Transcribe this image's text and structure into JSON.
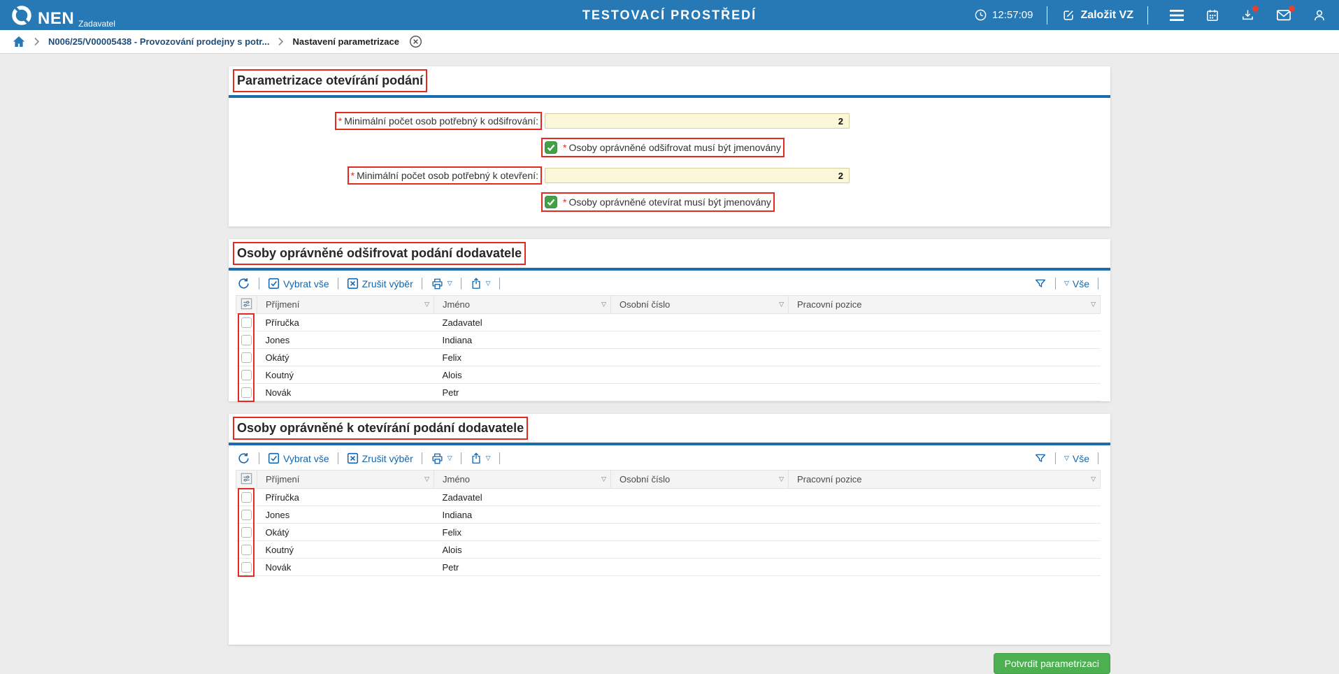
{
  "header": {
    "app_name": "NEN",
    "app_subtitle": "Zadavatel",
    "environment_label": "TESTOVACÍ PROSTŘEDÍ",
    "time": "12:57:09",
    "create_vz_label": "Založit VZ"
  },
  "breadcrumb": {
    "contract_link": "N006/25/V00005438 - Provozování prodejny s potr...",
    "current_page": "Nastavení parametrizace"
  },
  "parametrization": {
    "title": "Parametrizace otevírání podání",
    "required_mark": "*",
    "decrypt_count_label": "Minimální počet osob potřebný k odšifrování:",
    "decrypt_count_value": "2",
    "decrypt_named_label": "Osoby oprávněné odšifrovat musí být jmenovány",
    "decrypt_named_checked": true,
    "open_count_label": "Minimální počet osob potřebný k otevření:",
    "open_count_value": "2",
    "open_named_label": "Osoby oprávněné otevírat musí být jmenovány",
    "open_named_checked": true
  },
  "grid_toolbar": {
    "select_all": "Vybrat vše",
    "clear_selection": "Zrušit výběr",
    "all_filter": "Vše"
  },
  "decrypt_table": {
    "title": "Osoby oprávněné odšifrovat podání dodavatele",
    "columns": [
      "Příjmení",
      "Jméno",
      "Osobní číslo",
      "Pracovní pozice"
    ],
    "rows": [
      [
        "Příručka",
        "Zadavatel",
        "",
        ""
      ],
      [
        "Jones",
        "Indiana",
        "",
        ""
      ],
      [
        "Okátý",
        "Felix",
        "",
        ""
      ],
      [
        "Koutný",
        "Alois",
        "",
        ""
      ],
      [
        "Novák",
        "Petr",
        "",
        ""
      ]
    ]
  },
  "open_table": {
    "title": "Osoby oprávněné k otevírání podání dodavatele",
    "columns": [
      "Příjmení",
      "Jméno",
      "Osobní číslo",
      "Pracovní pozice"
    ],
    "rows": [
      [
        "Příručka",
        "Zadavatel",
        "",
        ""
      ],
      [
        "Jones",
        "Indiana",
        "",
        ""
      ],
      [
        "Okátý",
        "Felix",
        "",
        ""
      ],
      [
        "Koutný",
        "Alois",
        "",
        ""
      ],
      [
        "Novák",
        "Petr",
        "",
        ""
      ]
    ]
  },
  "footer": {
    "confirm_label": "Potvrdit parametrizaci"
  },
  "icons": {
    "dropdown_triangle": "▽"
  },
  "colors": {
    "header_blue": "#2779B6",
    "divider_blue": "#1B6DAD",
    "toolbar_blue": "#1366AD",
    "annotation_red": "#E02B20",
    "input_yellow": "#FBF8D9",
    "checkbox_green": "#43A047",
    "button_green": "#4CAF50",
    "badge_red": "#E8402E",
    "page_background": "#ECECEC"
  }
}
